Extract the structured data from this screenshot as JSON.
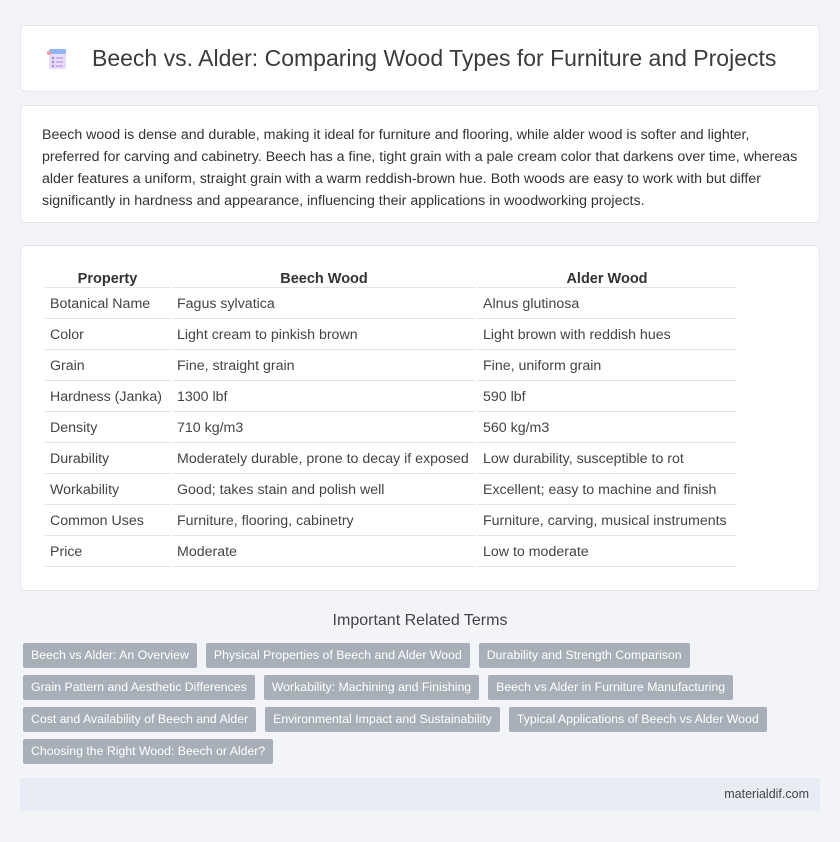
{
  "header": {
    "title": "Beech vs. Alder: Comparing Wood Types for Furniture and Projects",
    "logo_icon": "document-list-icon"
  },
  "intro": {
    "text": "Beech wood is dense and durable, making it ideal for furniture and flooring, while alder wood is softer and lighter, preferred for carving and cabinetry. Beech has a fine, tight grain with a pale cream color that darkens over time, whereas alder features a uniform, straight grain with a warm reddish-brown hue. Both woods are easy to work with but differ significantly in hardness and appearance, influencing their applications in woodworking projects."
  },
  "table": {
    "headers": [
      "Property",
      "Beech Wood",
      "Alder Wood"
    ],
    "rows": [
      [
        "Botanical Name",
        "Fagus sylvatica",
        "Alnus glutinosa"
      ],
      [
        "Color",
        "Light cream to pinkish brown",
        "Light brown with reddish hues"
      ],
      [
        "Grain",
        "Fine, straight grain",
        "Fine, uniform grain"
      ],
      [
        "Hardness (Janka)",
        "1300 lbf",
        "590 lbf"
      ],
      [
        "Density",
        "710 kg/m3",
        "560 kg/m3"
      ],
      [
        "Durability",
        "Moderately durable, prone to decay if exposed",
        "Low durability, susceptible to rot"
      ],
      [
        "Workability",
        "Good; takes stain and polish well",
        "Excellent; easy to machine and finish"
      ],
      [
        "Common Uses",
        "Furniture, flooring, cabinetry",
        "Furniture, carving, musical instruments"
      ],
      [
        "Price",
        "Moderate",
        "Low to moderate"
      ]
    ]
  },
  "related": {
    "title": "Important Related Terms",
    "tags": [
      "Beech vs Alder: An Overview",
      "Physical Properties of Beech and Alder Wood",
      "Durability and Strength Comparison",
      "Grain Pattern and Aesthetic Differences",
      "Workability: Machining and Finishing",
      "Beech vs Alder in Furniture Manufacturing",
      "Cost and Availability of Beech and Alder",
      "Environmental Impact and Sustainability",
      "Typical Applications of Beech vs Alder Wood",
      "Choosing the Right Wood: Beech or Alder?"
    ]
  },
  "footer": {
    "site": "materialdif.com"
  }
}
